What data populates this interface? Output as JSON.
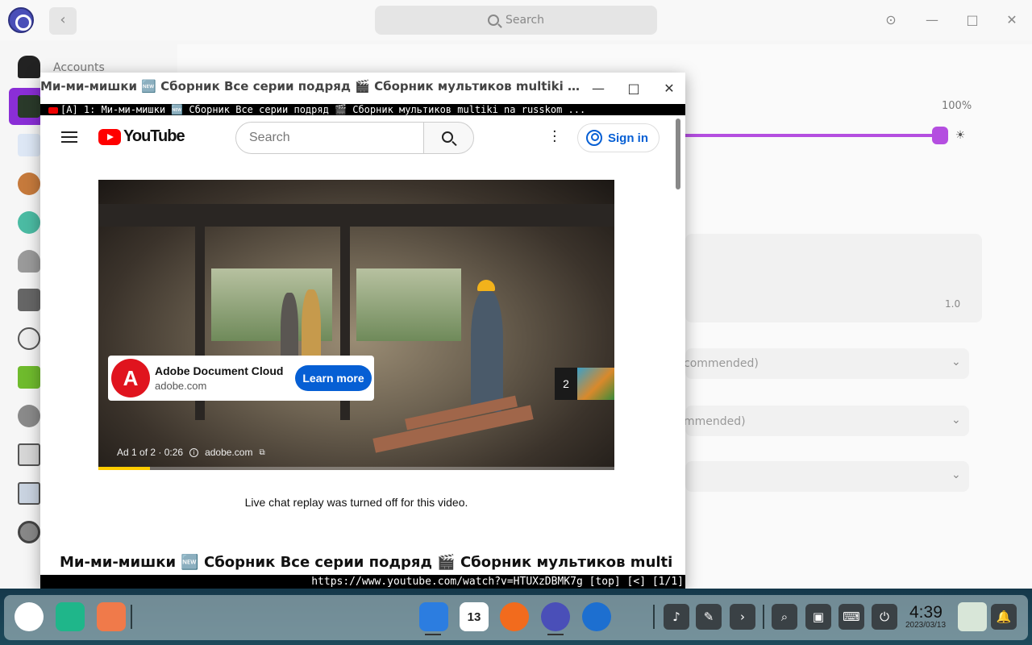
{
  "settings": {
    "search_placeholder": "Search",
    "sidebar_first_label": "Accounts",
    "brightness_percent": "100%",
    "scale_value": "1.0",
    "dropdown_1": "commended)",
    "dropdown_2": "mmended)"
  },
  "browser": {
    "window_title": "Ми-ми-мишки 🆕 Сборник Все серии подряд 🎬 Сборник мультиков multiki na russkom ...",
    "tab_text": "[A] 1: Ми-ми-мишки 🆕 Сборник Все серии подряд 🎬 Сборник мультиков multiki na russkom ...",
    "status_url": "https://www.youtube.com/watch?v=HTUXzDBMK7g [top] [<] [1/1]"
  },
  "youtube": {
    "logo_text": "YouTube",
    "search_placeholder": "Search",
    "signin_label": "Sign in",
    "ad": {
      "advertiser": "Adobe Document Cloud",
      "domain": "adobe.com",
      "cta": "Learn more",
      "info": "Ad 1 of 2 · 0:26",
      "link": "adobe.com",
      "next_count": "2",
      "progress_fraction": 0.1
    },
    "live_chat_notice": "Live chat replay was turned off for this video.",
    "video_title": "Ми-ми-мишки 🆕 Сборник Все серии подряд 🎬 Сборник мультиков multiki na"
  },
  "taskbar": {
    "calendar_day": "13",
    "time": "4:39",
    "date": "2023/03/13"
  },
  "colors": {
    "accent_purple": "#8a2ed6",
    "youtube_red": "#ff0000",
    "link_blue": "#065fd4",
    "ad_progress": "#ffcc00"
  }
}
